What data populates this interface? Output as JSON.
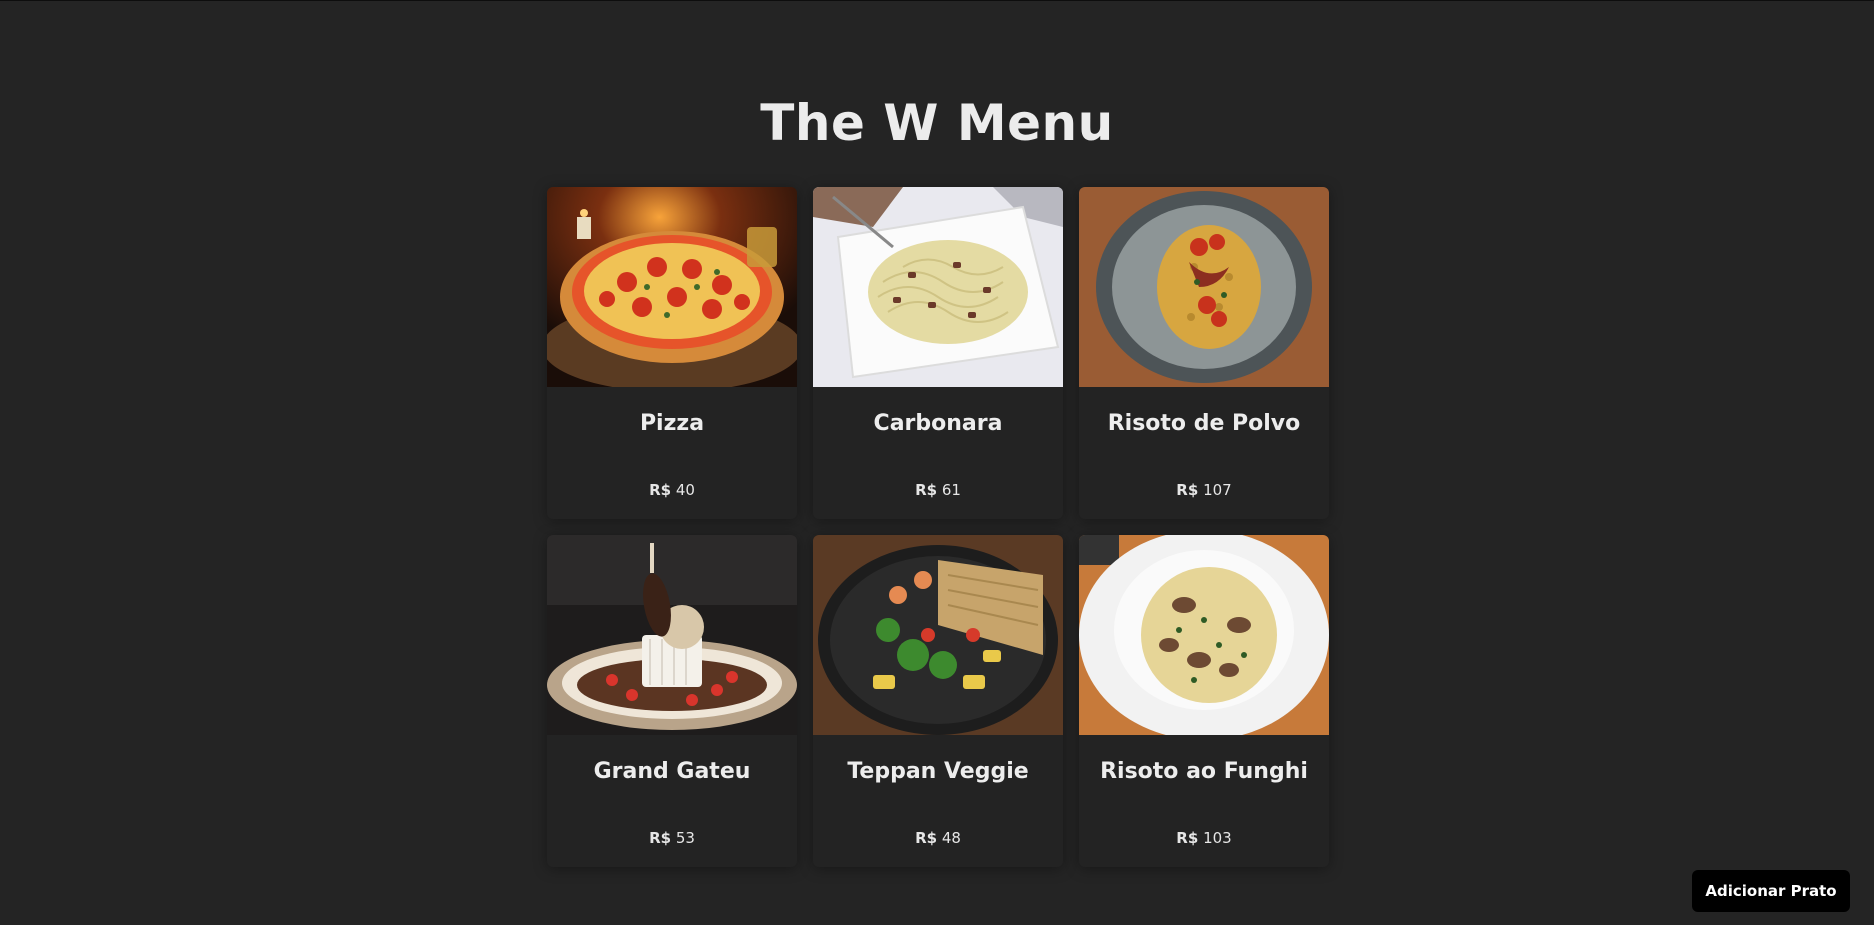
{
  "page": {
    "title": "The W Menu"
  },
  "menu": {
    "items": [
      {
        "name": "Pizza",
        "currency": "R$",
        "price": "40",
        "image": "pizza-photo"
      },
      {
        "name": "Carbonara",
        "currency": "R$",
        "price": "61",
        "image": "carbonara-photo"
      },
      {
        "name": "Risoto de Polvo",
        "currency": "R$",
        "price": "107",
        "image": "octopus-risotto-photo"
      },
      {
        "name": "Grand Gateu",
        "currency": "R$",
        "price": "53",
        "image": "ice-cream-dessert-photo"
      },
      {
        "name": "Teppan Veggie",
        "currency": "R$",
        "price": "48",
        "image": "sizzling-veggies-photo"
      },
      {
        "name": "Risoto ao Funghi",
        "currency": "R$",
        "price": "103",
        "image": "mushroom-risotto-photo"
      }
    ]
  },
  "actions": {
    "add_label": "Adicionar Prato"
  },
  "colors": {
    "background": "#242424",
    "card": "#232323",
    "button": "#000000",
    "text": "#e6e6e6"
  }
}
